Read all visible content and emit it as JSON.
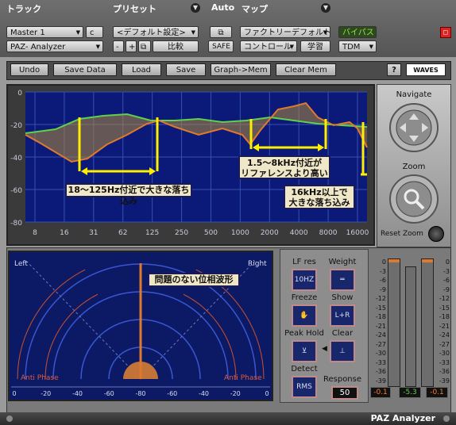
{
  "header": {
    "track_label": "トラック",
    "preset_label": "プリセット",
    "auto_label": "Auto",
    "map_label": "マップ",
    "track_name": "Master 1",
    "track_channel": "c",
    "preset_name": "<デフォルト設定>",
    "plugin_name": "PAZ- Analyzer",
    "minus": "-",
    "plus": "+",
    "compare": "比較",
    "safe": "SAFE",
    "factory_default": "ファクトリーデフォルト",
    "bypass": "バイパス",
    "control": "コントロール",
    "learn": "学習",
    "tdm": "TDM"
  },
  "toolbar": {
    "undo": "Undo",
    "save_data": "Save Data",
    "load": "Load",
    "save": "Save",
    "graph_mem": "Graph->Mem",
    "clear_mem": "Clear Mem",
    "help": "?",
    "brand": "WAVES"
  },
  "graph": {
    "y_ticks": [
      "0",
      "-20",
      "-40",
      "-60",
      "-80"
    ],
    "x_ticks": [
      "8",
      "16",
      "31",
      "62",
      "125",
      "250",
      "500",
      "1000",
      "2000",
      "4000",
      "8000",
      "16000"
    ],
    "annotations": {
      "low": "18〜125Hz付近で大きな落ち込み",
      "mid_line1": "1.5〜8kHz付近が",
      "mid_line2": "リファレンスより高い",
      "high_line1": "16kHz以上で",
      "high_line2": "大きな落ち込み"
    },
    "colors": {
      "reference": "#5fd14a",
      "current": "#e07a2a",
      "marker": "#ffee00",
      "background": "#0b1a78"
    }
  },
  "nav": {
    "navigate": "Navigate",
    "zoom": "Zoom",
    "reset_zoom": "Reset Zoom"
  },
  "phase": {
    "left": "Left",
    "right": "Right",
    "anti_left": "Anti Phase",
    "anti_right": "Anti Phase",
    "annotation": "問題のない位相波形",
    "x_ticks": [
      "0",
      "-20",
      "-40",
      "-60",
      "-80",
      "-60",
      "-40",
      "-20",
      "0"
    ]
  },
  "controls": {
    "lf_res": "LF res",
    "lf_res_value": "10HZ",
    "weight": "Weight",
    "freeze": "Freeze",
    "show": "Show",
    "show_value": "L+R",
    "peak_hold": "Peak Hold",
    "clear": "Clear",
    "detect": "Detect",
    "detect_value": "RMS",
    "response": "Response",
    "response_value": "50"
  },
  "meters": {
    "scale": [
      "0",
      "-3",
      "-6",
      "-9",
      "-12",
      "-15",
      "-18",
      "-21",
      "-24",
      "-27",
      "-30",
      "-33",
      "-36",
      "-39"
    ],
    "left_value": "-0.1",
    "mid_value": "-5.3",
    "right_value": "-0.1"
  },
  "footer": {
    "title": "PAZ Analyzer"
  }
}
